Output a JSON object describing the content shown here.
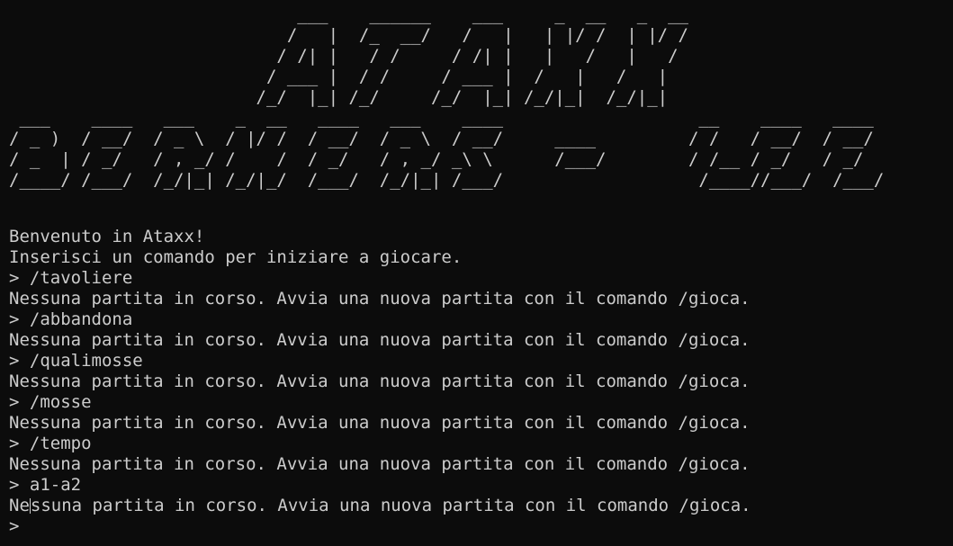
{
  "banner": {
    "title_art": "                            ___    ______    ___     _  __   _  __\n                           /   |  /_  __/   /   |   | |/ /  | |/ /\n                          / /| |   / /     / /| |   |   /   |   /\n                         / ___ |  / /     / ___ |  /   |   /   |\n                        /_/  |_| /_/     /_/  |_| /_/|_|  /_/|_|\n ___    ____   ___    _  __   ____   ___    ____                   __    ____   ____\n/ _ )  / __/  / _ \\  / |/ /  / __/  / _ \\  / __/     ____         / /   / __/  / __/\n/ _  | / _/   / , _/ /    /  / _/   / , _/ _\\ \\      /___/        / /__ / _/   / _/\n/____/ /___/  /_/|_| /_/|_/  /___/  /_/|_| /___/                   /____//___/  /___/"
  },
  "terminal": {
    "lines": [
      "Benvenuto in Ataxx!",
      "Inserisci un comando per iniziare a giocare.",
      "> /tavoliere",
      "Nessuna partita in corso. Avvia una nuova partita con il comando /gioca.",
      "> /abbandona",
      "Nessuna partita in corso. Avvia una nuova partita con il comando /gioca.",
      "> /qualimosse",
      "Nessuna partita in corso. Avvia una nuova partita con il comando /gioca.",
      "> /mosse",
      "Nessuna partita in corso. Avvia una nuova partita con il comando /gioca.",
      "> /tempo",
      "Nessuna partita in corso. Avvia una nuova partita con il comando /gioca.",
      "> a1-a2"
    ],
    "last_line_before_caret": "Ne",
    "last_line_after_caret": "ssuna partita in corso. Avvia una nuova partita con il comando /gioca.",
    "prompt_symbol": ">",
    "input_value": ""
  }
}
